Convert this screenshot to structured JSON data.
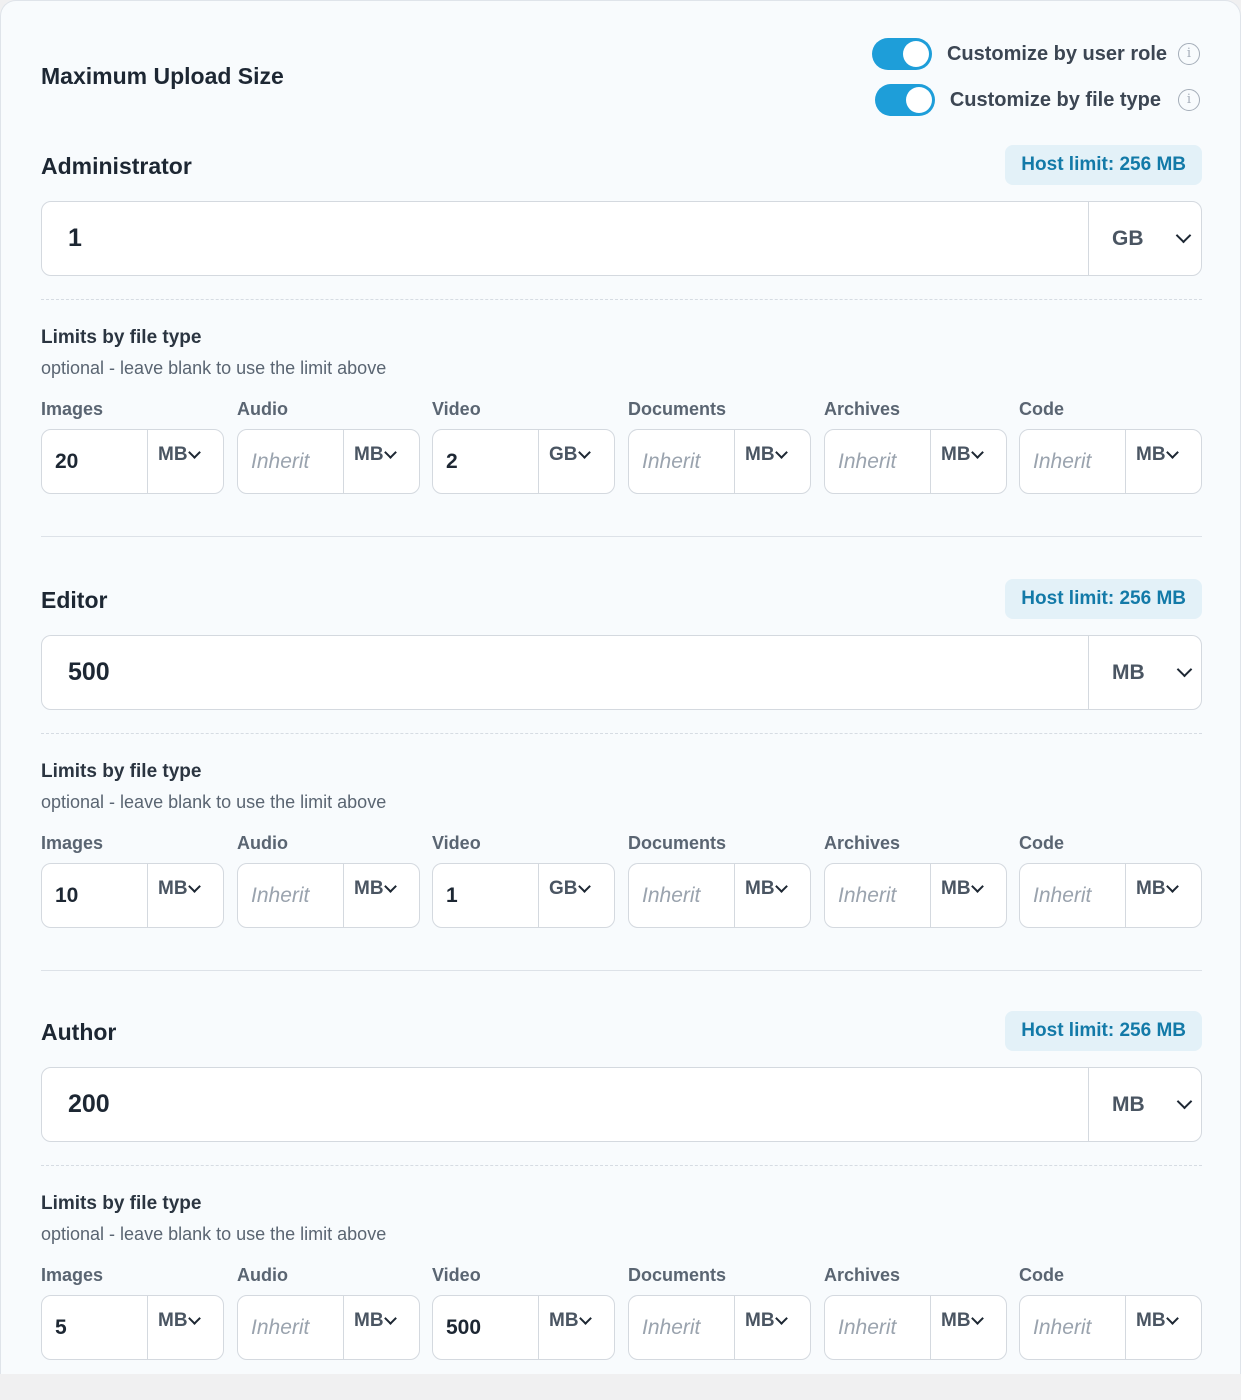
{
  "title": "Maximum Upload Size",
  "toggles": [
    {
      "label": "Customize by user role",
      "on": true
    },
    {
      "label": "Customize by file type",
      "on": true
    }
  ],
  "info_icon_glyph": "i",
  "file_types_title": "Limits by file type",
  "file_types_subtitle": "optional - leave blank to use the limit above",
  "file_type_labels": [
    "Images",
    "Audio",
    "Video",
    "Documents",
    "Archives",
    "Code"
  ],
  "inherit_placeholder": "Inherit",
  "accent_color": "#1e9ed9",
  "roles": [
    {
      "name": "Administrator",
      "host_limit": "Host limit: 256 MB",
      "value": "1",
      "unit": "GB",
      "file_types": [
        {
          "value": "20",
          "unit": "MB"
        },
        {
          "value": "",
          "unit": "MB"
        },
        {
          "value": "2",
          "unit": "GB"
        },
        {
          "value": "",
          "unit": "MB"
        },
        {
          "value": "",
          "unit": "MB"
        },
        {
          "value": "",
          "unit": "MB"
        }
      ]
    },
    {
      "name": "Editor",
      "host_limit": "Host limit: 256 MB",
      "value": "500",
      "unit": "MB",
      "file_types": [
        {
          "value": "10",
          "unit": "MB"
        },
        {
          "value": "",
          "unit": "MB"
        },
        {
          "value": "1",
          "unit": "GB"
        },
        {
          "value": "",
          "unit": "MB"
        },
        {
          "value": "",
          "unit": "MB"
        },
        {
          "value": "",
          "unit": "MB"
        }
      ]
    },
    {
      "name": "Author",
      "host_limit": "Host limit: 256 MB",
      "value": "200",
      "unit": "MB",
      "file_types": [
        {
          "value": "5",
          "unit": "MB"
        },
        {
          "value": "",
          "unit": "MB"
        },
        {
          "value": "500",
          "unit": "MB"
        },
        {
          "value": "",
          "unit": "MB"
        },
        {
          "value": "",
          "unit": "MB"
        },
        {
          "value": "",
          "unit": "MB"
        }
      ]
    }
  ]
}
